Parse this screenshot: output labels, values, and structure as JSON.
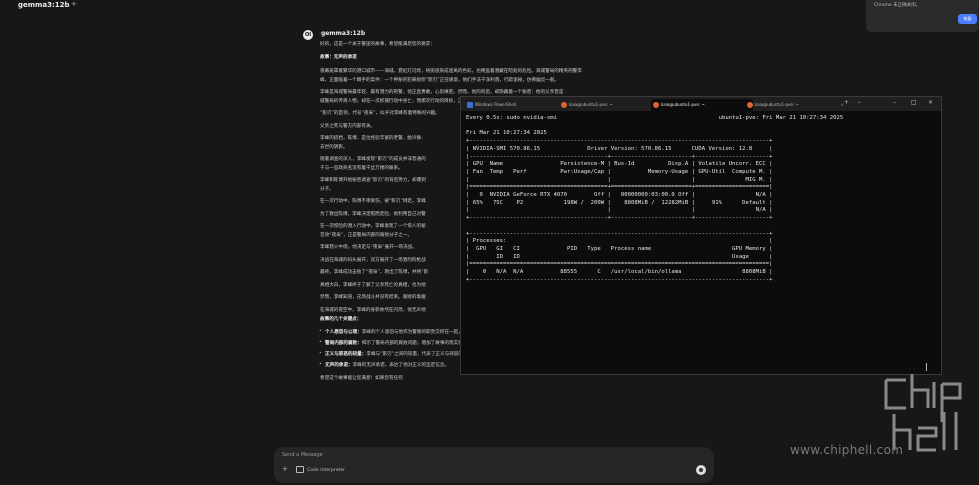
{
  "topbar": {
    "model": "gemma3:12b"
  },
  "notification": {
    "text": "Chrome 未正确关闭。",
    "button": "恢复"
  },
  "assistant": {
    "avatar": "OI",
    "name": "gemma3:12b",
    "intro": "好的，这是一个关于警匪的故事，希望能满足您的要求：",
    "story_title": "故事：无声的承诺",
    "lines": [
      "夜幕笼罩着繁华的港口城市——海城。霓虹灯闪烁，将街道染成迷离的色彩，也掩盖着潜藏在暗处的危险。海城警局的精英刑警李",
      "峰，正面临着一个棘手的案件：一个神秘的犯罪组织“影刃”正在肆虐，他们手法干净利落，行踪诡秘，仿佛幽灵一般。",
      "李峰是海城警局最年轻、最有潜力的刑警，他正直勇敢，心思缜密。然而，他的背后，却隐藏着一个秘密：他的父亲曾是",
      "城警局的传奇人物，却在一次抓捕行动中身亡，而那次行动的目标，正是“影刃”的前身。",
      "“影刃”的首领，代号“夜枭”，似乎对李峰有着特殊的兴趣。",
      "父亲之死与警方内部有关。",
      "李峰的搭档，陈博，是位经验丰富的老警，她冷静、",
      "去世的阴影。",
      "随着调查的深入，李峰发现“影刃”的成员并非普通的",
      "于与一些政商名流有着千丝万缕的联系。",
      "李峰和陈博开始秘密调查“影刃”的背后势力，却遭到",
      "分子。",
      "在一次行动中，陈博不幸受伤，被“影刃”绑走。李峰",
      "为了救出陈博，李峰决定铤而走险，他利用自己对警",
      "在一次惊险的潜入行动中，李峰发现了一个惊人的秘",
      "音效“夜枭”，正是警局内部的腐败分子之一。",
      "李峰怒火中烧，他决定与“夜枭”展开一场决战。",
      "决战在海城的码头展开，双方展开了一场激烈的枪战",
      "最终，李峰成功击败了“夜枭”，救出了陈博，并将“影",
      "真相大白，李峰终于了解了父亲死亡的真相，也为他",
      "然而，李峰知道，这场战斗并没有结束。腐败的毒瘤",
      "在海城的夜空中，李峰的身影依然在闪烁，他无声地"
    ],
    "elements_title": "故事的几个关键点：",
    "bullets": [
      {
        "bold": "个人恩怨与公理：",
        "text": "李峰的个人恩怨与他作为警察的职责交织在一起，增加了故事的深度。"
      },
      {
        "bold": "警局内部的腐败：",
        "text": "揭示了警局内部的腐败问题，增加了故事的现实感和讽刺意味。"
      },
      {
        "bold": "正义与邪恶的较量：",
        "text": "李峰与“影刃”之间的较量，代表了正义与邪恶的较量。"
      },
      {
        "bold": "无声的承诺：",
        "text": "李峰的无声承诺，表达了他对正义的坚定信念。"
      }
    ],
    "outro": "希望这个故事能让您满意！如果您有任何"
  },
  "composer": {
    "placeholder": "Send a Message",
    "code_interpreter": "Code Interpreter"
  },
  "terminal": {
    "tabs": [
      {
        "label": "Windows PowerShell",
        "icon": "powershell-icon",
        "active": false
      },
      {
        "label": "kaia@ubuntu1-pve: ~",
        "icon": "ubuntu-icon",
        "active": false
      },
      {
        "label": "kaia@ubuntu1-pve: ~",
        "icon": "ubuntu-icon",
        "active": true
      },
      {
        "label": "kaia@ubuntu1-pve: ~",
        "icon": "ubuntu-icon",
        "active": false
      }
    ],
    "lines": [
      "Every 0.5s: sudo nvidia-smi                                                ubuntu1-pve: Fri Mar 21 10:27:34 2025",
      "",
      "Fri Mar 21 10:27:34 2025",
      "+-----------------------------------------------------------------------------------------+",
      "| NVIDIA-SMI 570.86.15              Driver Version: 570.86.15      CUDA Version: 12.8     |",
      "|-----------------------------------------+------------------------+----------------------+",
      "| GPU  Name                 Persistence-M | Bus-Id          Disp.A | Volatile Uncorr. ECC |",
      "| Fan  Temp   Perf          Pwr:Usage/Cap |           Memory-Usage | GPU-Util  Compute M. |",
      "|                                         |                        |               MIG M. |",
      "|=========================================+========================+======================|",
      "|   0  NVIDIA GeForce RTX 4070        Off |   00000000:03:00.0 Off |                  N/A |",
      "| 65%   75C    P2            198W /  200W |    8808MiB /  12282MiB |     91%      Default |",
      "|                                         |                        |                  N/A |",
      "+-----------------------------------------+------------------------+----------------------+",
      "",
      "+-----------------------------------------------------------------------------------------+",
      "| Processes:                                                                              |",
      "|  GPU   GI   CI              PID   Type   Process name                        GPU Memory |",
      "|        ID   ID                                                               Usage      |",
      "|=========================================================================================|",
      "|    0   N/A  N/A           88555      C   /usr/local/bin/ollama                  8808MiB |",
      "+-----------------------------------------------------------------------------------------+"
    ]
  },
  "watermark": {
    "url": "www.chiphell.com"
  }
}
